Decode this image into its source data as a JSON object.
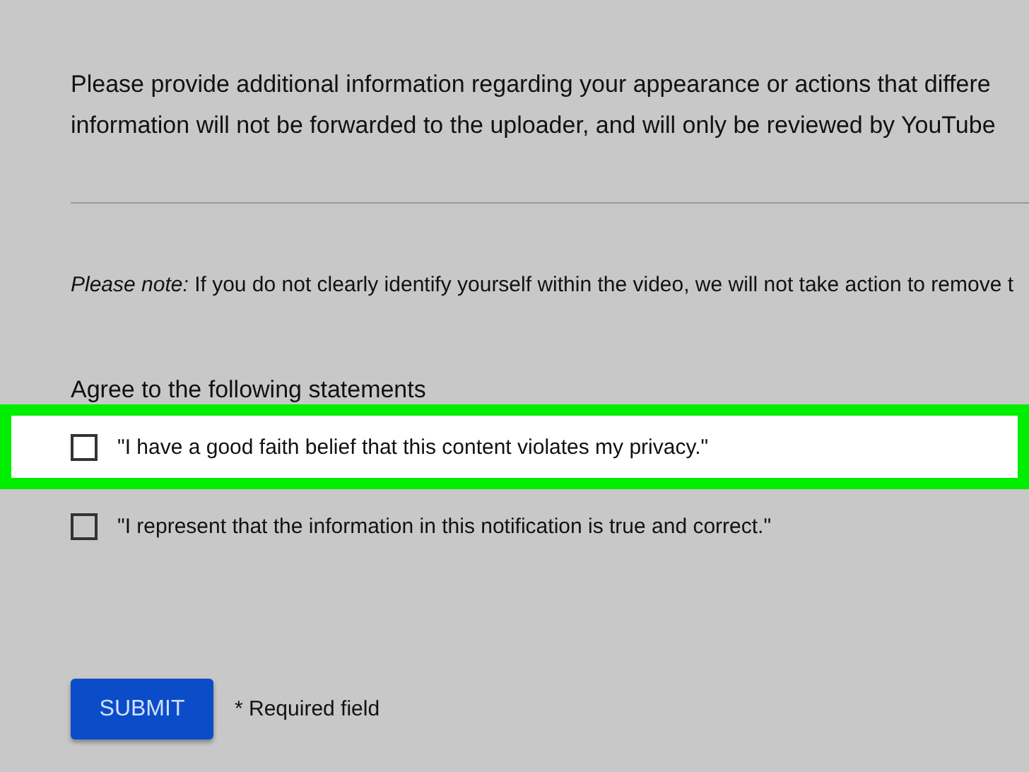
{
  "intro": [
    "Please provide additional information regarding your appearance or actions that differe",
    "information will not be forwarded to the uploader, and will only be reviewed by YouTube"
  ],
  "note": {
    "label": "Please note:",
    "text": " If you do not clearly identify yourself within the video, we will not take action to remove t"
  },
  "statements": {
    "heading": "Agree to the following statements",
    "items": [
      {
        "label": "\"I have a good faith belief that this content violates my privacy.\"",
        "checked": false,
        "highlighted": true
      },
      {
        "label": "\"I represent that the information in this notification is true and correct.\"",
        "checked": false,
        "highlighted": false
      }
    ]
  },
  "submit": {
    "label": "SUBMIT"
  },
  "required_note": "* Required field"
}
